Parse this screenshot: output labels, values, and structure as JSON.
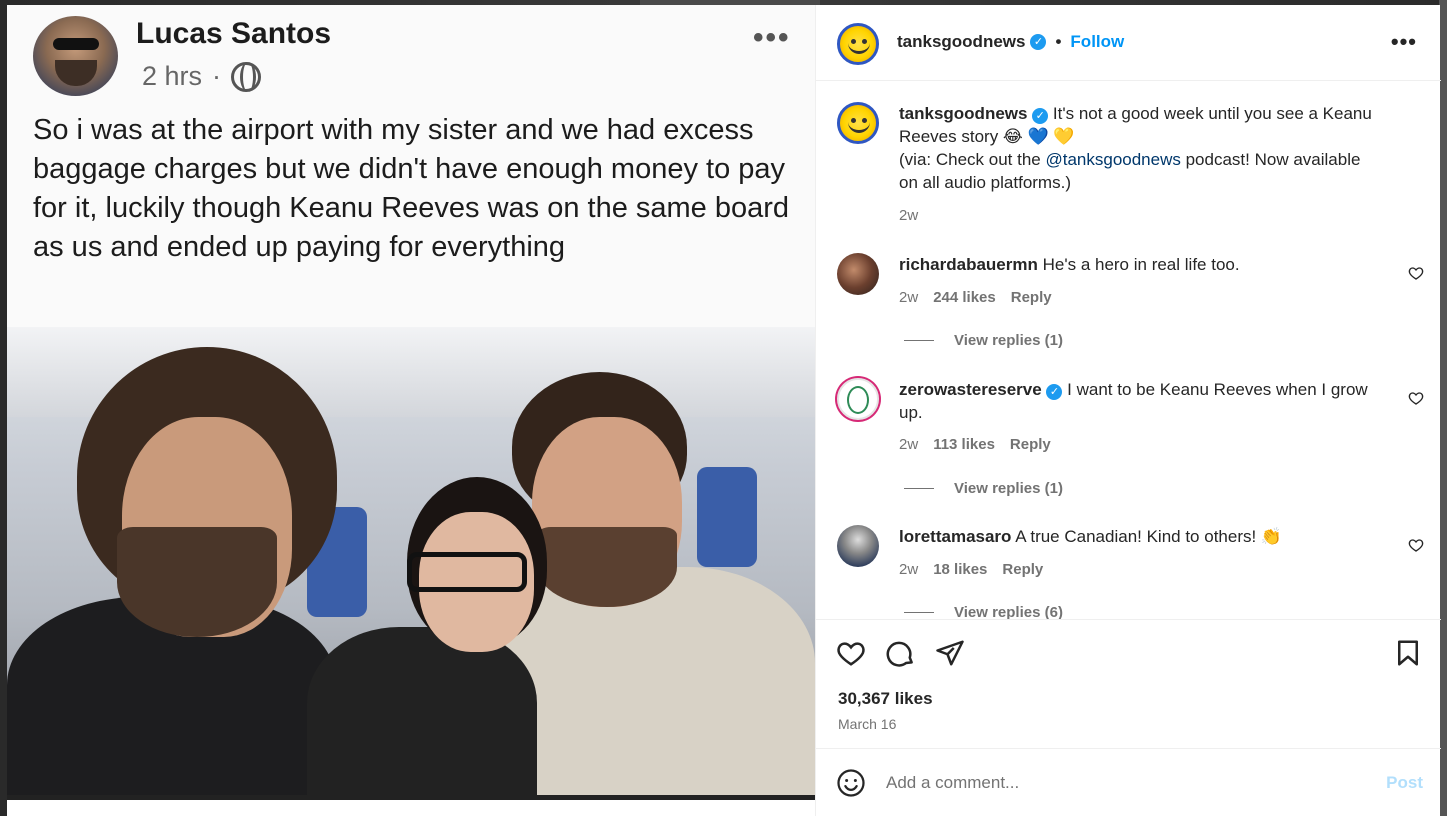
{
  "post_image": {
    "author_name": "Lucas Santos",
    "time": "2 hrs",
    "separator": "·",
    "more": "•••",
    "text": "So i was at the airport with my sister and we had excess baggage charges but we didn't have enough money to pay for it, luckily though Keanu Reeves was on the same board as us and ended up paying for everything"
  },
  "header": {
    "username": "tanksgoodnews",
    "verified_mark": "✓",
    "dot": "•",
    "follow_label": "Follow",
    "more": "•••"
  },
  "caption": {
    "username": "tanksgoodnews",
    "text_1": " It's not a good week until you see a Keanu Reeves story 😂 💙 💛",
    "text_2": "(via: Check out the ",
    "mention": "@tanksgoodnews",
    "text_3": " podcast! Now available on all audio platforms.)",
    "time": "2w"
  },
  "comments": [
    {
      "username": "richardabauermn",
      "text": " He's a hero in real life too.",
      "time": "2w",
      "likes": "244 likes",
      "reply": "Reply",
      "view_replies": "View replies (1)"
    },
    {
      "username": "zerowastereserve",
      "text": " I want to be Keanu Reeves when I grow up.",
      "time": "2w",
      "likes": "113 likes",
      "reply": "Reply",
      "view_replies": "View replies (1)"
    },
    {
      "username": "lorettamasaro",
      "text": " A true Canadian! Kind to others! 👏",
      "time": "2w",
      "likes": "18 likes",
      "reply": "Reply",
      "view_replies": "View replies (6)"
    }
  ],
  "engagement": {
    "likes": "30,367 likes",
    "date": "March 16"
  },
  "add_comment": {
    "placeholder": "Add a comment...",
    "post_label": "Post"
  },
  "colors": {
    "accent": "#0095f6",
    "text": "#262626",
    "muted": "#737373",
    "post_disabled": "#b2dffc"
  }
}
